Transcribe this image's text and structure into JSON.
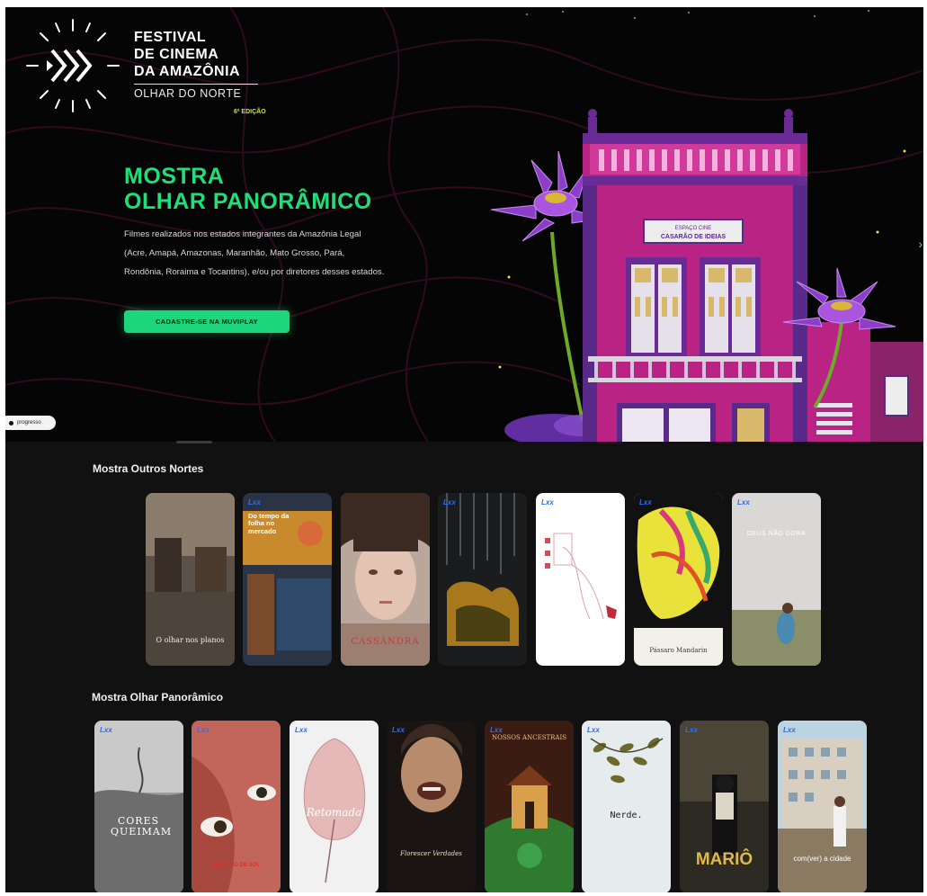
{
  "festival": {
    "line1": "FESTIVAL",
    "line2": "DE CINEMA",
    "line3": "DA AMAZÔNIA",
    "subtitle": "OLHAR DO NORTE",
    "edition": "6ª EDIÇÃO"
  },
  "hero": {
    "title_line1": "MOSTRA",
    "title_line2": "OLHAR PANORÂMICO",
    "description": "Filmes realizados nos estados integrantes da Amazônia Legal (Acre, Amapá, Amazonas, Maranhão, Mato Grosso, Pará, Rondônia, Roraima e Tocantins), e/ou por diretores desses estados.",
    "cta_label": "CADASTRE-SE NA MUVIPLAY",
    "building_sign_line1": "ESPAÇO CINE",
    "building_sign_line2": "CASARÃO DE IDEIAS",
    "progress_label": "progresso",
    "next_icon": "chevron-right-icon"
  },
  "sections": [
    {
      "title": "Mostra Outros Nortes",
      "cards": [
        {
          "badge": "Lxx",
          "title": "O olhar nos planos"
        },
        {
          "badge": "Lxx",
          "title": "Do tempo da folha no mercado"
        },
        {
          "badge": "",
          "title": "CASSANDRA"
        },
        {
          "badge": "Lxx",
          "title": ""
        },
        {
          "badge": "Lxx",
          "title": ""
        },
        {
          "badge": "Lxx",
          "title": "Pássaro Mandarin"
        },
        {
          "badge": "Lxx",
          "title": "DEUS NÃO DORA"
        }
      ]
    },
    {
      "title": "Mostra Olhar Panorâmico",
      "cards": [
        {
          "badge": "Lxx",
          "title": "CORES QUEIMAM"
        },
        {
          "badge": "Lxx",
          "title": "SEU RAIO DE SOL"
        },
        {
          "badge": "Lxx",
          "title": "Retomada"
        },
        {
          "badge": "Lxx",
          "title": "Florescer Verdades"
        },
        {
          "badge": "Lxx",
          "title": "NOSSOS ANCESTRAIS"
        },
        {
          "badge": "Lxx",
          "title": "Nerde."
        },
        {
          "badge": "Lxx",
          "title": "MARIÔ"
        },
        {
          "badge": "Lxx",
          "title": "com(ver) a cidade"
        }
      ]
    }
  ],
  "colors": {
    "accent_green": "#1ee07a",
    "background": "#111111",
    "hero_bg": "#050505",
    "building_magenta": "#c2258f",
    "building_purple": "#5a2a8a",
    "badge_blue": "#2a6cff"
  }
}
